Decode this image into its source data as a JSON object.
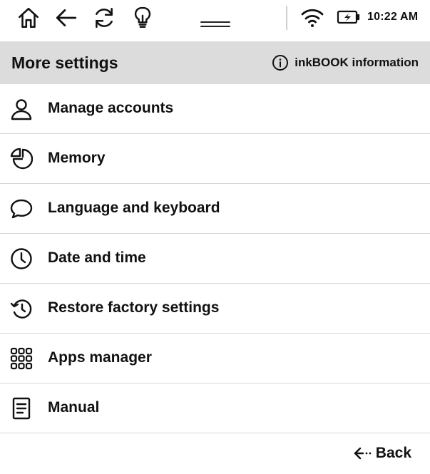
{
  "status_bar": {
    "icons": [
      "home-icon",
      "back-arrow-icon",
      "refresh-icon",
      "lightbulb-icon"
    ],
    "wifi_icon": "wifi-icon",
    "battery_icon": "battery-charging-icon",
    "time": "10:22 AM"
  },
  "header": {
    "title": "More settings",
    "info_label": "inkBOOK information",
    "info_icon": "info-icon"
  },
  "menu": {
    "items": [
      {
        "label": "Manage accounts",
        "icon": "user-icon"
      },
      {
        "label": "Memory",
        "icon": "pie-chart-icon"
      },
      {
        "label": "Language and keyboard",
        "icon": "speech-bubble-icon"
      },
      {
        "label": "Date and time",
        "icon": "clock-icon"
      },
      {
        "label": "Restore factory settings",
        "icon": "restore-icon"
      },
      {
        "label": "Apps manager",
        "icon": "apps-grid-icon"
      },
      {
        "label": "Manual",
        "icon": "document-icon"
      }
    ]
  },
  "footer": {
    "back_label": "Back",
    "back_icon": "back-arrow-icon"
  },
  "colors": {
    "header_bg": "#dcdcdc",
    "divider": "#d6d6d6",
    "text": "#111111",
    "background": "#ffffff"
  }
}
